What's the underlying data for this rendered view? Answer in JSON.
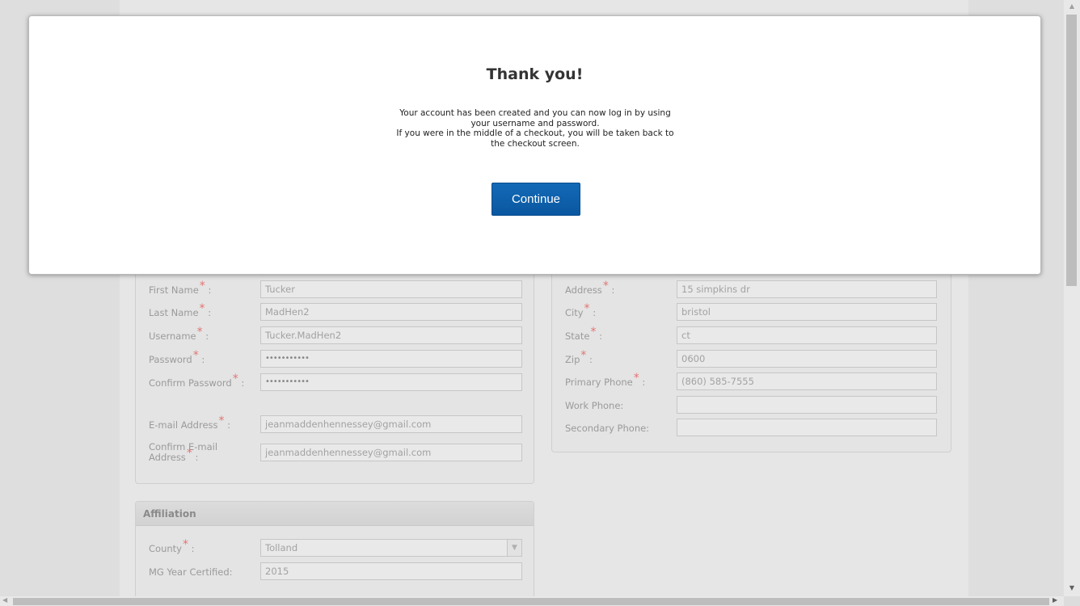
{
  "modal": {
    "title": "Thank you!",
    "message_lines": [
      "Your account has been created and you can now log in by using",
      "your username and password.",
      "If you were in the middle of a checkout, you will be taken back to",
      "the checkout screen."
    ],
    "continue_label": "Continue"
  },
  "required_marker": "*",
  "personal": {
    "first_name": {
      "label": "First Name",
      "value": "Tucker"
    },
    "last_name": {
      "label": "Last Name",
      "value": "MadHen2"
    },
    "username": {
      "label": "Username",
      "value": "Tucker.MadHen2"
    },
    "password": {
      "label": "Password",
      "value": "•••••••••••"
    },
    "confirm_password": {
      "label": "Confirm Password",
      "value": "•••••••••••"
    },
    "email": {
      "label": "E-mail Address",
      "value": "jeanmaddenhennessey@gmail.com"
    },
    "confirm_email": {
      "label_line1": "Confirm E-mail",
      "label_line2": "Address",
      "value": "jeanmaddenhennessey@gmail.com"
    }
  },
  "address": {
    "address": {
      "label": "Address",
      "value": "15 simpkins dr"
    },
    "city": {
      "label": "City",
      "value": "bristol"
    },
    "state": {
      "label": "State",
      "value": "ct"
    },
    "zip": {
      "label": "Zip",
      "value": "0600"
    },
    "primary_phone": {
      "label": "Primary Phone",
      "value": "(860) 585-7555"
    },
    "work_phone": {
      "label": "Work Phone:",
      "value": ""
    },
    "secondary_phone": {
      "label": "Secondary Phone:",
      "value": ""
    }
  },
  "affiliation": {
    "header": "Affiliation",
    "county": {
      "label": "County",
      "value": "Tolland"
    },
    "mg_year": {
      "label": "MG Year Certified:",
      "value": "2015"
    }
  },
  "colors": {
    "button": "#0a57a0",
    "required": "#e57373"
  },
  "icons": {
    "select_arrow": "chevron-down-icon"
  }
}
